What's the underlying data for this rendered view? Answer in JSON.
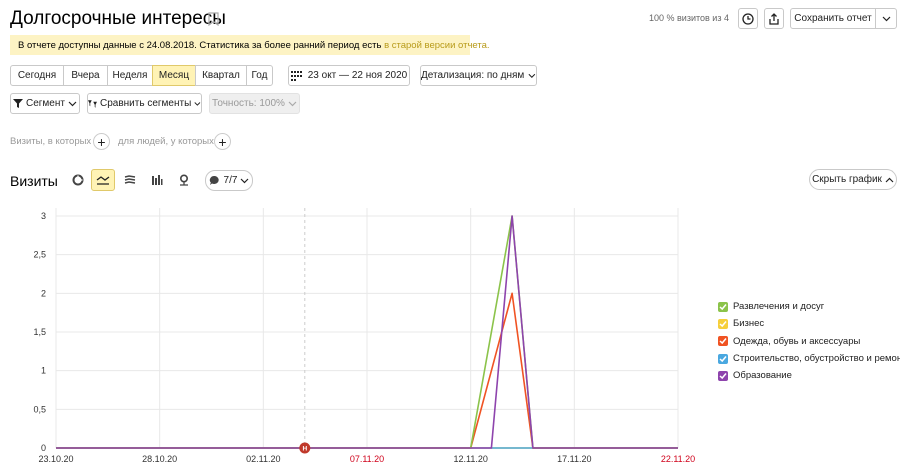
{
  "header": {
    "title": "Долгосрочные интересы",
    "visits_pct": "100 % визитов из 4",
    "save_label": "Сохранить отчет"
  },
  "notice": {
    "text": "В отчете доступны данные с 24.08.2018. Статистика за более ранний период есть",
    "link": "в старой версии отчета."
  },
  "periods": [
    {
      "label": "Сегодня"
    },
    {
      "label": "Вчера"
    },
    {
      "label": "Неделя"
    },
    {
      "label": "Месяц",
      "active": true
    },
    {
      "label": "Квартал"
    },
    {
      "label": "Год"
    }
  ],
  "date_range": "23 окт — 22 ноя 2020",
  "detail": "Детализация: по дням",
  "segment_label": "Сегмент",
  "compare_label": "Сравнить сегменты",
  "accuracy_label": "Точность: 100%",
  "filter": {
    "visits_where": "Визиты, в которых",
    "people_where": "для людей, у которых"
  },
  "chart_header": {
    "title": "Визиты",
    "series_count": "7/7",
    "hide_label": "Скрыть график"
  },
  "chart_data": {
    "type": "line",
    "ylim": [
      0,
      3
    ],
    "yticks": [
      "0",
      "0,5",
      "1",
      "1,5",
      "2",
      "2,5",
      "3"
    ],
    "xticks": [
      {
        "label": "23.10.20",
        "red": false
      },
      {
        "label": "28.10.20",
        "red": false
      },
      {
        "label": "02.11.20",
        "red": false
      },
      {
        "label": "07.11.20",
        "red": true
      },
      {
        "label": "12.11.20",
        "red": false
      },
      {
        "label": "17.11.20",
        "red": false
      },
      {
        "label": "22.11.20",
        "red": true
      }
    ],
    "marker_label": "Н",
    "series": [
      {
        "name": "Развлечения и досуг",
        "color": "#8bc34a",
        "points": [
          [
            "23.10.20",
            0
          ],
          [
            "12.11.20",
            0
          ],
          [
            "14.11.20",
            3
          ],
          [
            "15.11.20",
            0
          ],
          [
            "22.11.20",
            0
          ]
        ]
      },
      {
        "name": "Бизнес",
        "color": "#f6cf3c",
        "points": [
          [
            "23.10.20",
            0
          ],
          [
            "22.11.20",
            0
          ]
        ]
      },
      {
        "name": "Одежда, обувь и аксессуары",
        "color": "#f05323",
        "points": [
          [
            "23.10.20",
            0
          ],
          [
            "12.11.20",
            0
          ],
          [
            "14.11.20",
            2
          ],
          [
            "15.11.20",
            0
          ],
          [
            "22.11.20",
            0
          ]
        ]
      },
      {
        "name": "Строительство, обустройство и ремонт",
        "color": "#4aa8e0",
        "points": [
          [
            "23.10.20",
            0
          ],
          [
            "22.11.20",
            0
          ]
        ]
      },
      {
        "name": "Образование",
        "color": "#8e44ad",
        "points": [
          [
            "23.10.20",
            0
          ],
          [
            "13.11.20",
            0
          ],
          [
            "14.11.20",
            3
          ],
          [
            "15.11.20",
            0
          ],
          [
            "22.11.20",
            0
          ]
        ]
      }
    ]
  }
}
